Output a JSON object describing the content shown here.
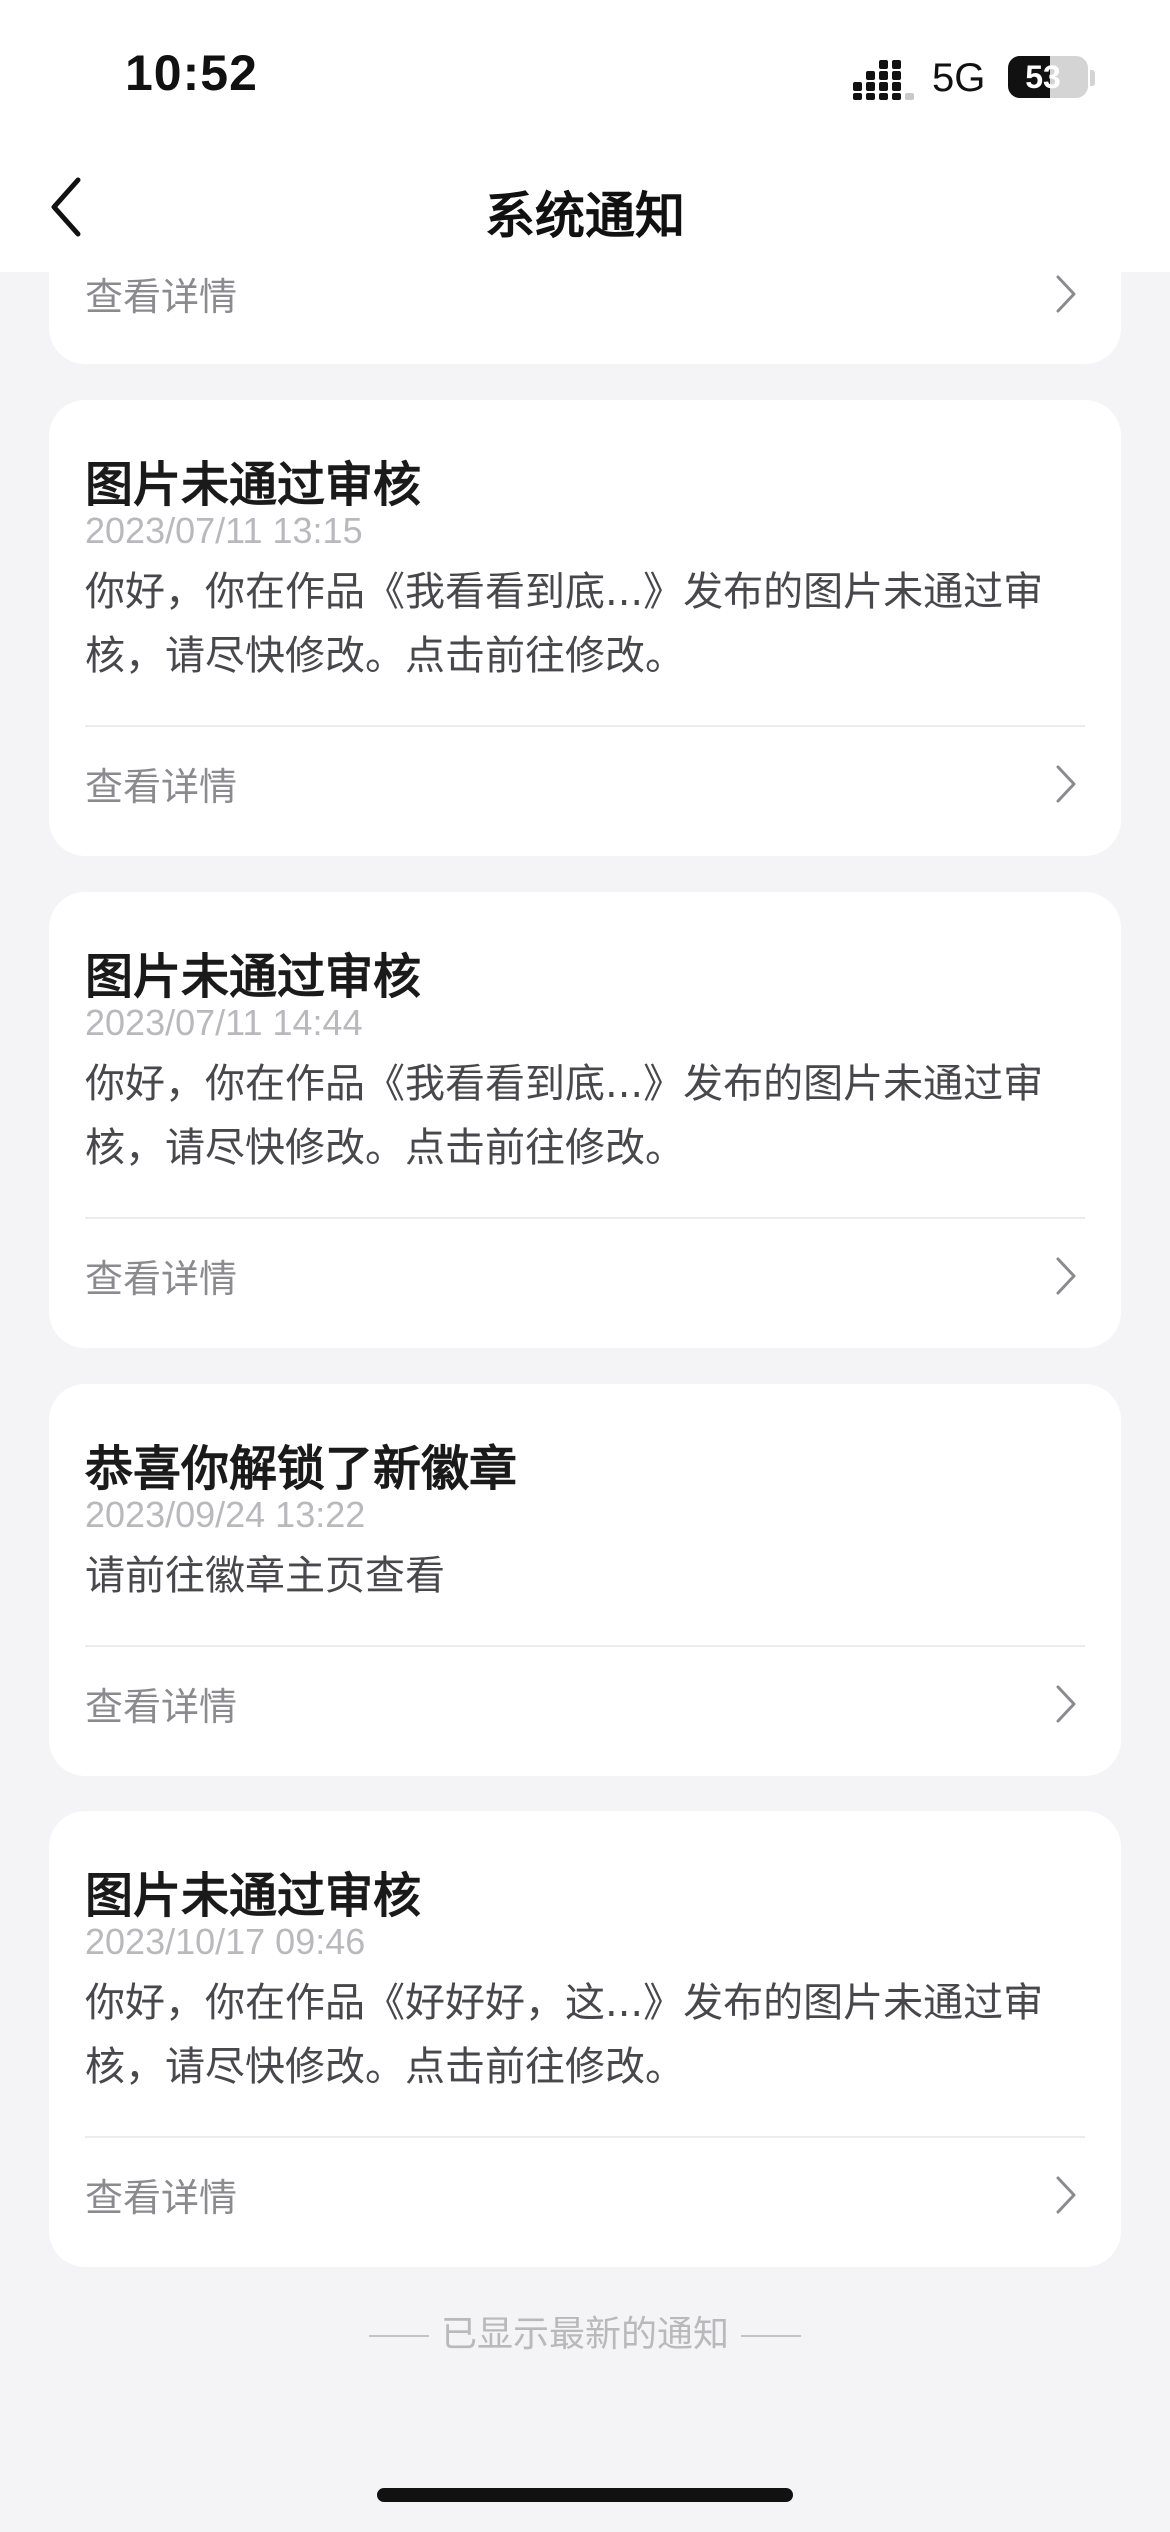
{
  "status_bar": {
    "time": "10:52",
    "network": "5G",
    "battery_percent": "53",
    "battery_level": 0.53
  },
  "nav": {
    "back_icon": "chevron-left-icon",
    "title": "系统通知"
  },
  "partial_card": {
    "detail_label": "查看详情"
  },
  "notifications": [
    {
      "title": "图片未通过审核",
      "time": "2023/07/11 13:15",
      "body": "你好，你在作品《我看看到底...》发布的图片未通过审核，请尽快修改。点击前往修改。",
      "detail_label": "查看详情"
    },
    {
      "title": "图片未通过审核",
      "time": "2023/07/11 14:44",
      "body": "你好，你在作品《我看看到底...》发布的图片未通过审核，请尽快修改。点击前往修改。",
      "detail_label": "查看详情"
    },
    {
      "title": "恭喜你解锁了新徽章",
      "time": "2023/09/24 13:22",
      "body": "请前往徽章主页查看",
      "detail_label": "查看详情"
    },
    {
      "title": "图片未通过审核",
      "time": "2023/10/17 09:46",
      "body": "你好，你在作品《好好好，这...》发布的图片未通过审核，请尽快修改。点击前往修改。",
      "detail_label": "查看详情"
    }
  ],
  "footer": {
    "note": "已显示最新的通知"
  },
  "colors": {
    "background": "#f4f4f6",
    "card": "#ffffff",
    "title": "#1a1a1a",
    "timestamp": "#b9b9bd",
    "body": "#48484c",
    "detail": "#8a8a8f"
  }
}
